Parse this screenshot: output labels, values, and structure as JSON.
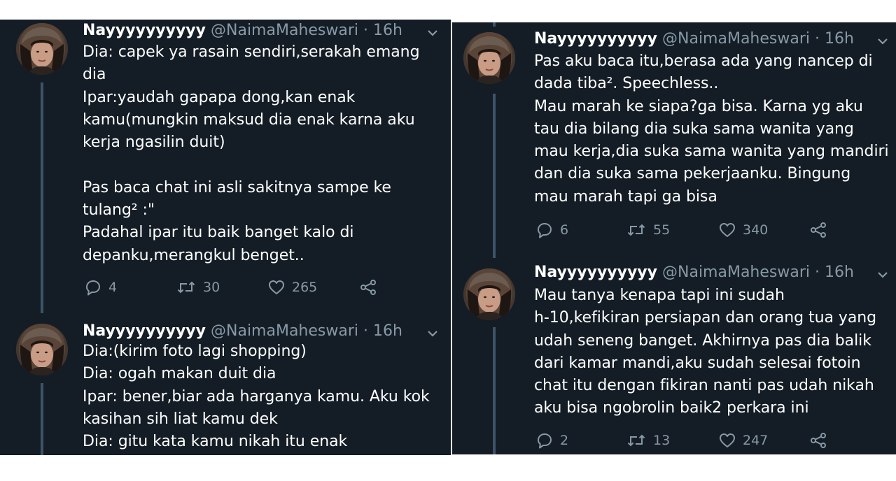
{
  "left_panel": {
    "tweets": [
      {
        "name": "Nayyyyyyyyyy",
        "handle": "@NaimaMaheswari",
        "sep": " · ",
        "time": "16h",
        "text": "Dia: capek ya rasain sendiri,serakah emang\ndia\nIpar:yaudah gapapa dong,kan enak\nkamu(mungkin maksud dia enak karna aku\nkerja ngasilin duit)\n\nPas baca chat ini asli sakitnya sampe ke\ntulang² :\"\nPadahal ipar itu baik banget kalo di\ndepanku,merangkul benget..",
        "replies": "4",
        "retweets": "30",
        "likes": "265"
      },
      {
        "name": "Nayyyyyyyyyy",
        "handle": "@NaimaMaheswari",
        "sep": " · ",
        "time": "16h",
        "text": "Dia:(kirim foto lagi shopping)\nDia: ogah makan duit dia\nIpar: bener,biar ada harganya kamu. Aku kok\nkasihan sih liat kamu dek\nDia: gitu kata kamu nikah itu enak"
      }
    ]
  },
  "right_panel": {
    "tweets": [
      {
        "name": "Nayyyyyyyyyy",
        "handle": "@NaimaMaheswari",
        "sep": " · ",
        "time": "16h",
        "text": "Pas aku baca itu,berasa ada yang nancep di\ndada tiba². Speechless..\nMau marah ke siapa?ga bisa. Karna yg aku\ntau dia bilang dia suka sama wanita yang\nmau kerja,dia suka sama wanita yang mandiri\ndan dia suka sama pekerjaanku. Bingung\nmau marah tapi ga bisa",
        "replies": "6",
        "retweets": "55",
        "likes": "340"
      },
      {
        "name": "Nayyyyyyyyyy",
        "handle": "@NaimaMaheswari",
        "sep": " · ",
        "time": "16h",
        "text": "Mau tanya kenapa tapi ini sudah\nh-10,kefikiran persiapan dan orang tua yang\nudah seneng banget. Akhirnya pas dia balik\ndari kamar mandi,aku sudah selesai fotoin\nchat itu dengan fikiran nanti pas udah nikah\naku bisa ngobrolin baik2 perkara ini",
        "replies": "2",
        "retweets": "13",
        "likes": "247"
      }
    ]
  },
  "icons": {
    "reply": "reply-icon",
    "retweet": "retweet-icon",
    "like": "heart-icon",
    "share": "share-icon",
    "more": "chevron-down-icon"
  },
  "colors": {
    "background": "#141d26",
    "text": "#ffffff",
    "secondary": "#8899a6",
    "thread_line": "#3d5466"
  }
}
